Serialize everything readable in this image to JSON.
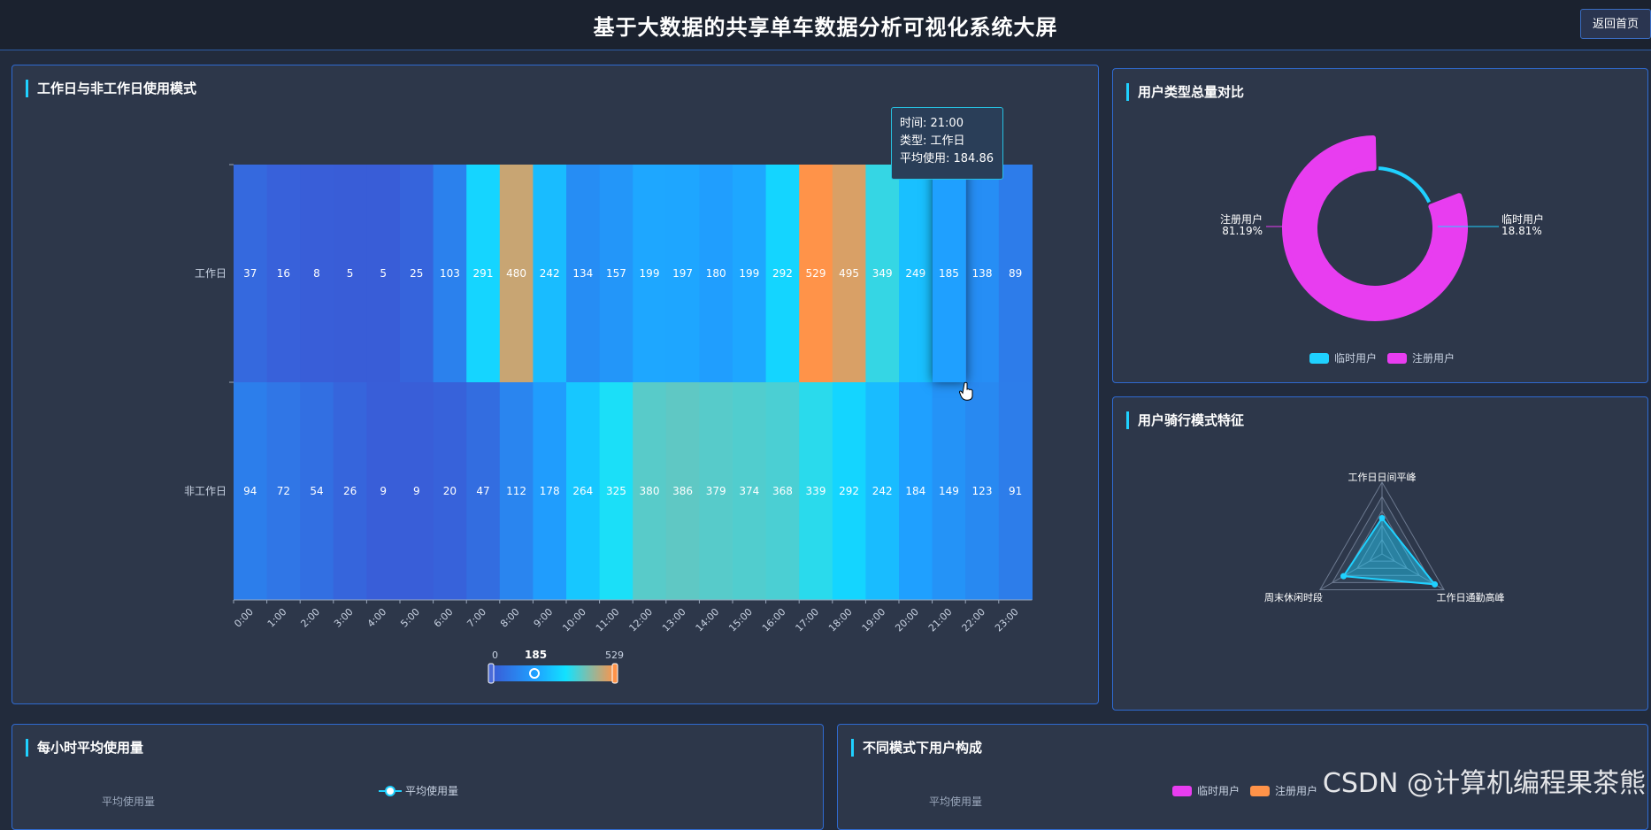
{
  "header": {
    "title": "基于大数据的共享单车数据分析可视化系统大屏",
    "home_button": "返回首页"
  },
  "heatmap_panel": {
    "title": "工作日与非工作日使用模式",
    "tooltip": {
      "time": "时间: 21:00",
      "type": "类型: 工作日",
      "avg": "平均使用: 184.86"
    },
    "visual_map": {
      "min": "0",
      "max": "529",
      "current": "185"
    }
  },
  "donut_panel": {
    "title": "用户类型总量对比",
    "labels": {
      "registered_name": "注册用户",
      "registered_pct": "81.19%",
      "casual_name": "临时用户",
      "casual_pct": "18.81%"
    },
    "legend": [
      "临时用户",
      "注册用户"
    ]
  },
  "radar_panel": {
    "title": "用户骑行模式特征",
    "indicators": [
      "工作日日间平峰",
      "工作日通勤高峰",
      "周末休闲时段"
    ]
  },
  "hourly_panel": {
    "title": "每小时平均使用量",
    "y_name": "平均使用量",
    "legend": "平均使用量"
  },
  "composition_panel": {
    "title": "不同模式下用户构成",
    "y_name": "平均使用量",
    "legend": [
      "临时用户",
      "注册用户"
    ]
  },
  "watermark": "CSDN @计算机编程果茶熊",
  "colors": {
    "accent": "#1fd1ff",
    "casual": "#1fd1ff",
    "registered": "#e83df0",
    "orange": "#ff9349"
  },
  "chart_data": [
    {
      "type": "heatmap",
      "title": "工作日与非工作日使用模式",
      "x": [
        "0:00",
        "1:00",
        "2:00",
        "3:00",
        "4:00",
        "5:00",
        "6:00",
        "7:00",
        "8:00",
        "9:00",
        "10:00",
        "11:00",
        "12:00",
        "13:00",
        "14:00",
        "15:00",
        "16:00",
        "17:00",
        "18:00",
        "19:00",
        "20:00",
        "21:00",
        "22:00",
        "23:00"
      ],
      "y": [
        "工作日",
        "非工作日"
      ],
      "values": [
        [
          37,
          16,
          8,
          5,
          5,
          25,
          103,
          291,
          480,
          242,
          134,
          157,
          199,
          197,
          180,
          199,
          292,
          529,
          495,
          349,
          249,
          185,
          138,
          89
        ],
        [
          94,
          72,
          54,
          26,
          9,
          9,
          20,
          47,
          112,
          178,
          264,
          325,
          380,
          386,
          379,
          374,
          368,
          339,
          292,
          242,
          184,
          149,
          123,
          91
        ]
      ],
      "range": [
        0,
        529
      ]
    },
    {
      "type": "pie",
      "title": "用户类型总量对比",
      "categories": [
        "临时用户",
        "注册用户"
      ],
      "values": [
        18.81,
        81.19
      ]
    },
    {
      "type": "radar",
      "title": "用户骑行模式特征",
      "indicators": [
        "工作日日间平峰",
        "工作日通勤高峰",
        "周末休闲时段"
      ],
      "values": [
        0.5,
        0.85,
        0.62
      ]
    }
  ]
}
